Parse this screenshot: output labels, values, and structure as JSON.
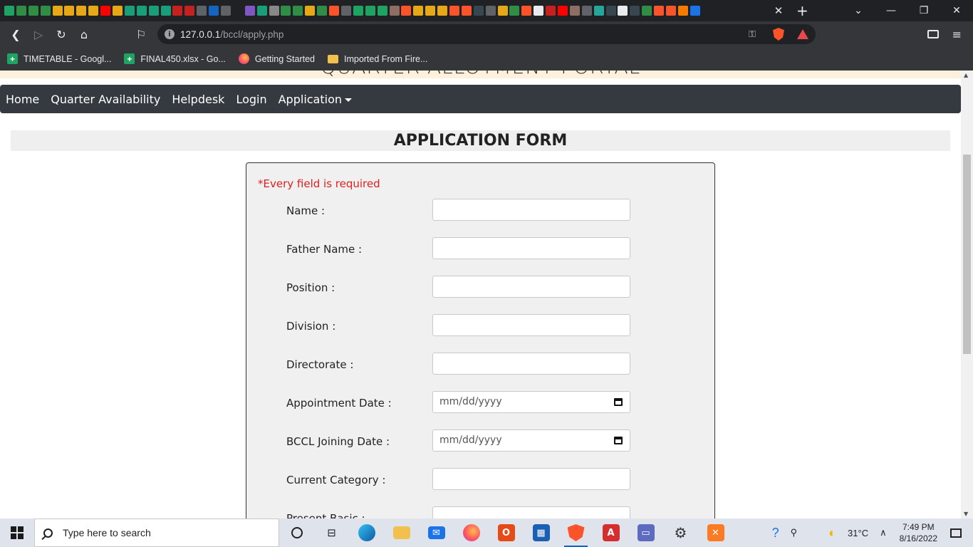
{
  "browser": {
    "url_host": "127.0.0.1",
    "url_path": "/bccl/apply.php",
    "tab_close": "✕",
    "new_tab": "+",
    "bookmarks": [
      {
        "label": "TIMETABLE - Googl...",
        "icon": "sheets-icon"
      },
      {
        "label": "FINAL450.xlsx - Go...",
        "icon": "sheets-icon"
      },
      {
        "label": "Getting Started",
        "icon": "firefox-icon"
      },
      {
        "label": "Imported From Fire...",
        "icon": "folder-icon"
      }
    ]
  },
  "site": {
    "title": "QUARTER ALLOTMENT PORTAL",
    "nav": {
      "home": "Home",
      "availability": "Quarter Availability",
      "helpdesk": "Helpdesk",
      "login": "Login",
      "application": "Application"
    }
  },
  "form": {
    "heading": "APPLICATION FORM",
    "required_note": "*Every field is required",
    "fields": [
      {
        "label": "Name :",
        "value": ""
      },
      {
        "label": "Father Name :",
        "value": ""
      },
      {
        "label": "Position :",
        "value": ""
      },
      {
        "label": "Division :",
        "value": ""
      },
      {
        "label": "Directorate :",
        "value": ""
      },
      {
        "label": "Appointment Date :",
        "value": "mm/dd/yyyy"
      },
      {
        "label": "BCCL Joining Date :",
        "value": "mm/dd/yyyy"
      },
      {
        "label": "Current Category :",
        "value": ""
      },
      {
        "label": "Present Basic :",
        "value": ""
      }
    ]
  },
  "taskbar": {
    "search_placeholder": "Type here to search",
    "temperature": "31°C",
    "time": "7:49 PM",
    "date": "8/16/2022"
  },
  "colors": {
    "navbar": "#343a40",
    "required": "#e02020",
    "card": "#f0f0f0"
  }
}
